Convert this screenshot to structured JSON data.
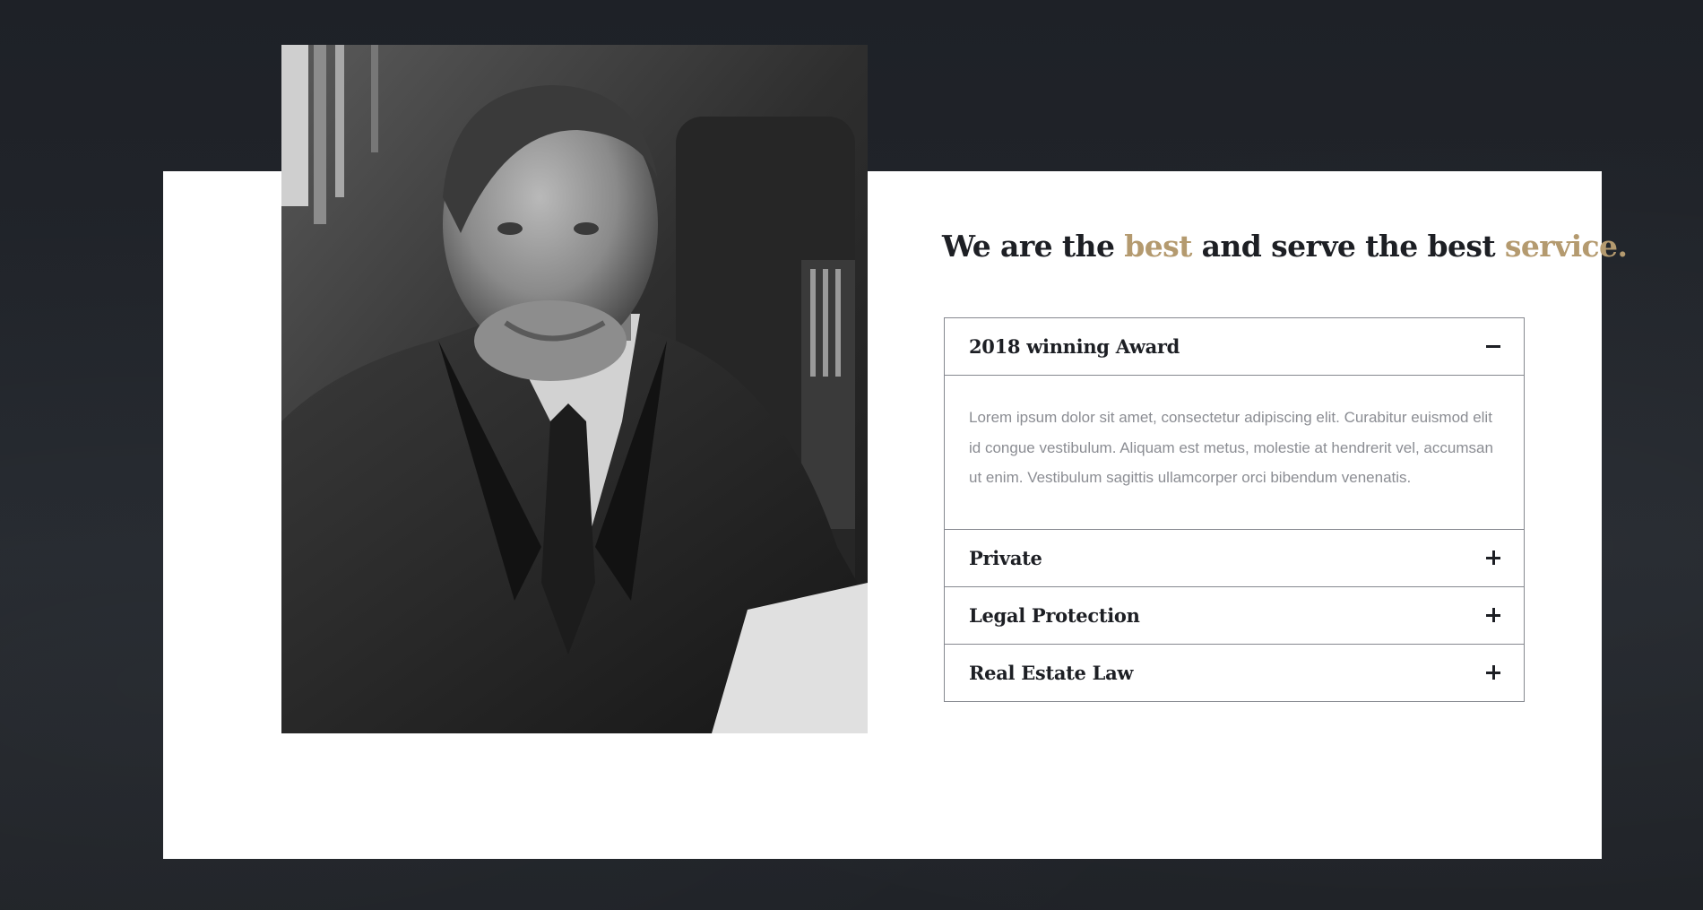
{
  "headline": {
    "part1": "We are the ",
    "accent1": "best",
    "part2": " and serve the best ",
    "accent2": "service."
  },
  "accordion": {
    "items": [
      {
        "title": "2018 winning Award",
        "expanded": true,
        "icon": "minus-icon",
        "body": "Lorem ipsum dolor sit amet, consectetur adipiscing elit. Curabitur euismod elit id congue vestibulum. Aliquam est metus, molestie at hendrerit vel, accumsan ut enim. Vestibulum sagittis ullamcorper orci bibendum venenatis."
      },
      {
        "title": "Private",
        "expanded": false,
        "icon": "plus-icon"
      },
      {
        "title": "Legal Protection",
        "expanded": false,
        "icon": "plus-icon"
      },
      {
        "title": "Real Estate Law",
        "expanded": false,
        "icon": "plus-icon"
      }
    ]
  },
  "colors": {
    "page_background": "#1f2228",
    "card_background": "#ffffff",
    "accent": "#b49a6f",
    "heading_text": "#1d1f24",
    "body_text": "#8b8d93",
    "border": "#85888f"
  }
}
